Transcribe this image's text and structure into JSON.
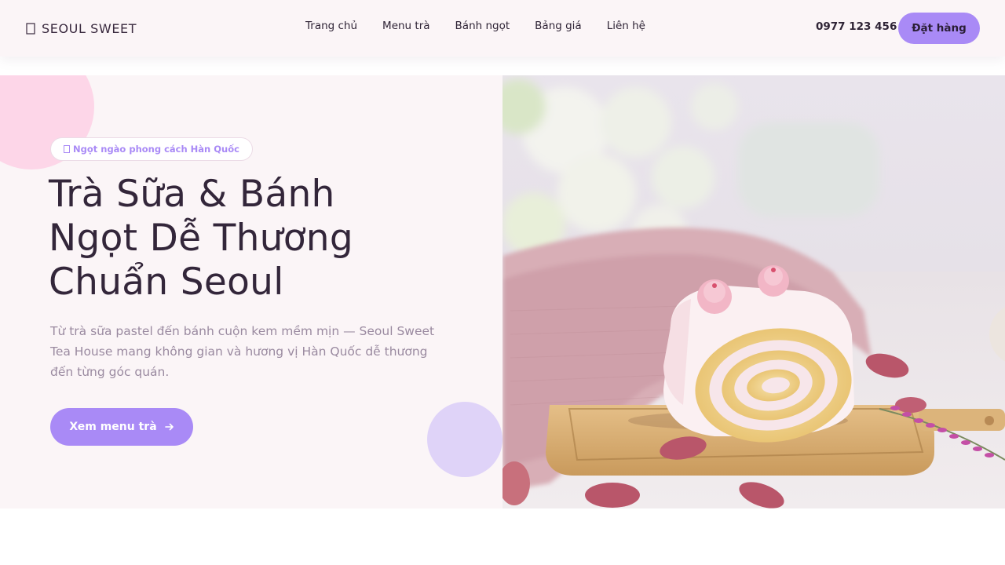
{
  "brand": {
    "name": "SEOUL SWEET",
    "logo_icon": "leaf-icon"
  },
  "nav": {
    "items": [
      {
        "label": "Trang chủ"
      },
      {
        "label": "Menu trà"
      },
      {
        "label": "Bánh ngọt"
      },
      {
        "label": "Bảng giá"
      },
      {
        "label": "Liên hệ"
      }
    ]
  },
  "header": {
    "phone": "0977 123 456",
    "order_label": "Đặt hàng"
  },
  "hero": {
    "tag": "Ngọt ngào phong cách Hàn Quốc",
    "tag_icon": "sparkle-icon",
    "title_lines": [
      "Trà Sữa & Bánh",
      "Ngọt Dễ Thương",
      "Chuẩn Seoul"
    ],
    "description": "Từ trà sữa pastel đến bánh cuộn kem mềm mịn — Seoul Sweet Tea House mang không gian và hương vị Hàn Quốc dễ thương đến từng góc quán.",
    "cta_label": "Xem menu trà",
    "cta_icon": "arrow-right-icon",
    "image": "roll-cake-photo"
  },
  "colors": {
    "accent": "#a98af6",
    "header_bg": "#fbf5f7",
    "hero_bg": "#fbf5f7",
    "title": "#33263a",
    "body_text": "#9a8aa0",
    "blob_pink": "#fdd6e8",
    "blob_purple": "#dfd3f8"
  }
}
